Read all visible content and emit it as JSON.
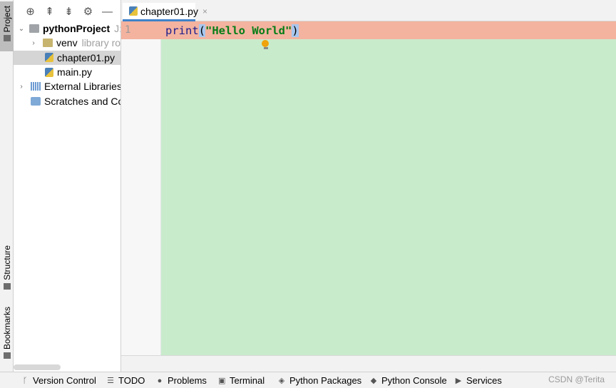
{
  "left_strip": {
    "project_label": "Project",
    "structure_label": "Structure",
    "bookmarks_label": "Bookmarks"
  },
  "project_toolbar": {
    "locate_icon": "crosshair-icon",
    "expand_icon": "expand-all-icon",
    "collapse_icon": "collapse-all-icon",
    "settings_icon": "gear-icon",
    "hide_icon": "minus-icon"
  },
  "tree": {
    "root": {
      "name": "pythonProject",
      "path": "J:\\"
    },
    "venv": {
      "name": "venv",
      "note": "library ro"
    },
    "file1": "chapter01.py",
    "file2": "main.py",
    "external": "External Libraries",
    "scratches": "Scratches and Co"
  },
  "editor": {
    "tab_label": "chapter01.py",
    "tab_close": "×",
    "line_number": "1",
    "code": {
      "func": "print",
      "open_paren": "(",
      "string": "\"Hello World\"",
      "close_paren": ")"
    }
  },
  "statusbar": {
    "version_control": "Version Control",
    "todo": "TODO",
    "problems": "Problems",
    "terminal": "Terminal",
    "python_packages": "Python Packages",
    "python_console": "Python Console",
    "services": "Services",
    "watermark": "CSDN @Terita"
  },
  "colors": {
    "highlight_line": "#f3b39f",
    "editor_bg": "#c8ebcc",
    "tab_underline": "#4083c9"
  }
}
